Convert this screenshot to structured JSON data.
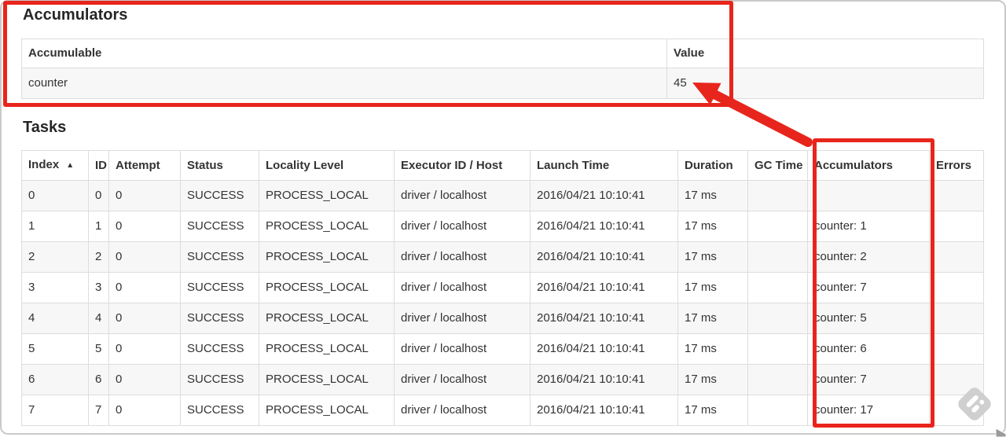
{
  "accumulators_section": {
    "title": "Accumulators",
    "table": {
      "headers": {
        "accumulable": "Accumulable",
        "value": "Value"
      },
      "rows": [
        {
          "accumulable": "counter",
          "value": "45"
        }
      ]
    }
  },
  "tasks_section": {
    "title": "Tasks",
    "table": {
      "sort_icon": "▲",
      "headers": {
        "index": "Index",
        "id": "ID",
        "attempt": "Attempt",
        "status": "Status",
        "locality_level": "Locality Level",
        "executor_id_host": "Executor ID / Host",
        "launch_time": "Launch Time",
        "duration": "Duration",
        "gc_time": "GC Time",
        "accumulators": "Accumulators",
        "errors": "Errors"
      },
      "rows": [
        {
          "index": "0",
          "id": "0",
          "attempt": "0",
          "status": "SUCCESS",
          "locality_level": "PROCESS_LOCAL",
          "executor_id_host": "driver / localhost",
          "launch_time": "2016/04/21 10:10:41",
          "duration": "17 ms",
          "gc_time": "",
          "accumulators": "",
          "errors": ""
        },
        {
          "index": "1",
          "id": "1",
          "attempt": "0",
          "status": "SUCCESS",
          "locality_level": "PROCESS_LOCAL",
          "executor_id_host": "driver / localhost",
          "launch_time": "2016/04/21 10:10:41",
          "duration": "17 ms",
          "gc_time": "",
          "accumulators": "counter: 1",
          "errors": ""
        },
        {
          "index": "2",
          "id": "2",
          "attempt": "0",
          "status": "SUCCESS",
          "locality_level": "PROCESS_LOCAL",
          "executor_id_host": "driver / localhost",
          "launch_time": "2016/04/21 10:10:41",
          "duration": "17 ms",
          "gc_time": "",
          "accumulators": "counter: 2",
          "errors": ""
        },
        {
          "index": "3",
          "id": "3",
          "attempt": "0",
          "status": "SUCCESS",
          "locality_level": "PROCESS_LOCAL",
          "executor_id_host": "driver / localhost",
          "launch_time": "2016/04/21 10:10:41",
          "duration": "17 ms",
          "gc_time": "",
          "accumulators": "counter: 7",
          "errors": ""
        },
        {
          "index": "4",
          "id": "4",
          "attempt": "0",
          "status": "SUCCESS",
          "locality_level": "PROCESS_LOCAL",
          "executor_id_host": "driver / localhost",
          "launch_time": "2016/04/21 10:10:41",
          "duration": "17 ms",
          "gc_time": "",
          "accumulators": "counter: 5",
          "errors": ""
        },
        {
          "index": "5",
          "id": "5",
          "attempt": "0",
          "status": "SUCCESS",
          "locality_level": "PROCESS_LOCAL",
          "executor_id_host": "driver / localhost",
          "launch_time": "2016/04/21 10:10:41",
          "duration": "17 ms",
          "gc_time": "",
          "accumulators": "counter: 6",
          "errors": ""
        },
        {
          "index": "6",
          "id": "6",
          "attempt": "0",
          "status": "SUCCESS",
          "locality_level": "PROCESS_LOCAL",
          "executor_id_host": "driver / localhost",
          "launch_time": "2016/04/21 10:10:41",
          "duration": "17 ms",
          "gc_time": "",
          "accumulators": "counter: 7",
          "errors": ""
        },
        {
          "index": "7",
          "id": "7",
          "attempt": "0",
          "status": "SUCCESS",
          "locality_level": "PROCESS_LOCAL",
          "executor_id_host": "driver / localhost",
          "launch_time": "2016/04/21 10:10:41",
          "duration": "17 ms",
          "gc_time": "",
          "accumulators": "counter: 17",
          "errors": ""
        }
      ]
    }
  },
  "annotations": {
    "highlight_color": "#e8251c",
    "box1_name": "accumulators-summary-highlight",
    "box2_name": "accumulators-column-highlight",
    "arrow_name": "column-to-total-arrow"
  }
}
